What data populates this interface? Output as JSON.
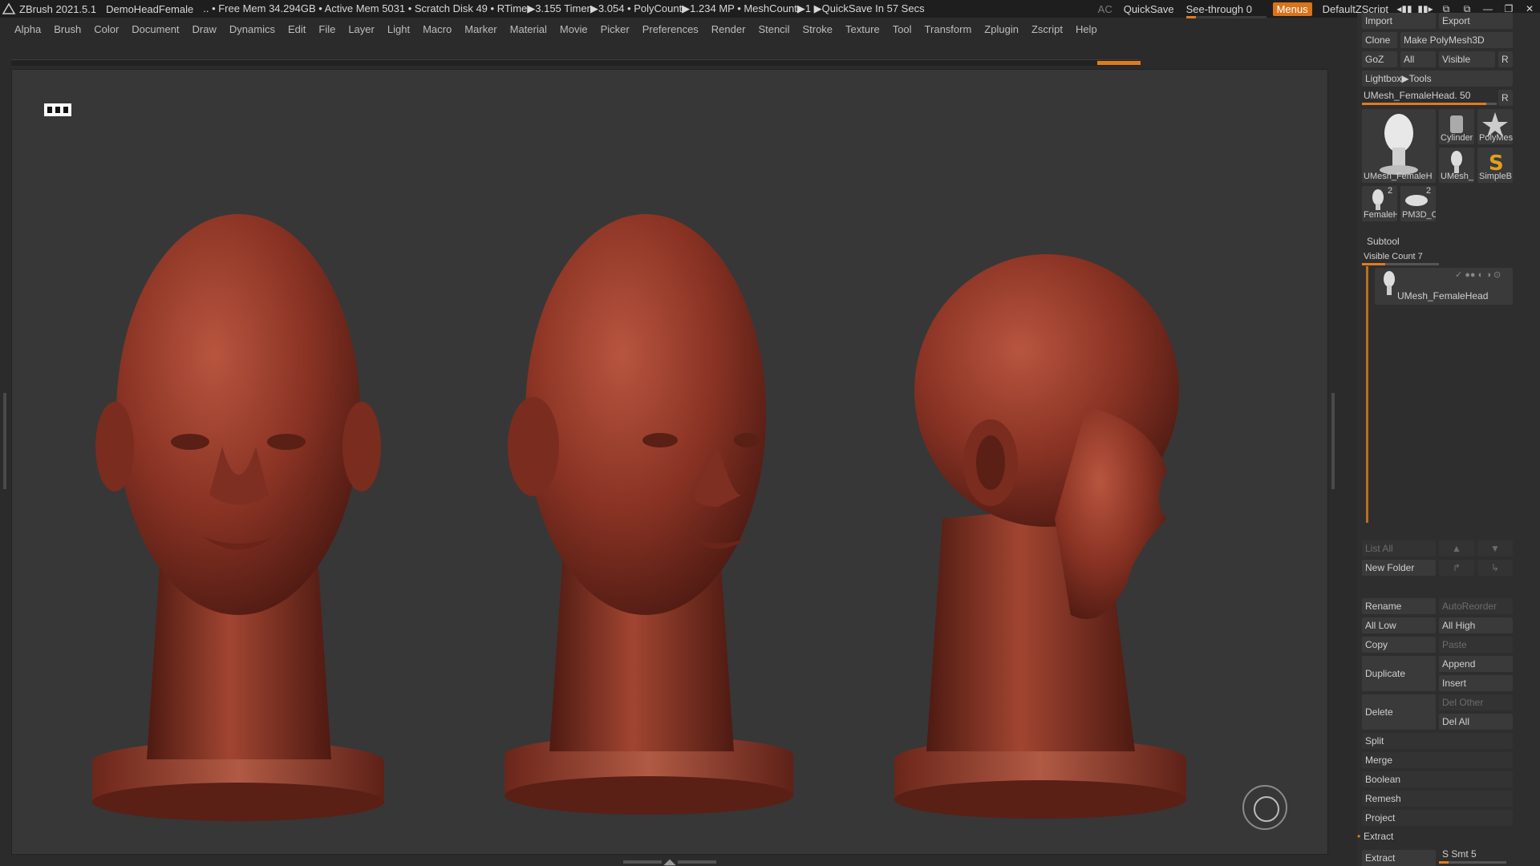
{
  "titlebar": {
    "app": "ZBrush 2021.5.1",
    "document": "DemoHeadFemale",
    "stats": ".. • Free Mem 34.294GB • Active Mem 5031 • Scratch Disk 49 • RTime▶3.155 Timer▶3.054 • PolyCount▶1.234 MP • MeshCount▶1 ▶QuickSave In 57 Secs",
    "ac": "AC",
    "quicksave": "QuickSave",
    "seethrough_label": "See-through",
    "seethrough_value": "0",
    "menus": "Menus",
    "zscript": "DefaultZScript"
  },
  "menubar": [
    "Alpha",
    "Brush",
    "Color",
    "Document",
    "Draw",
    "Dynamics",
    "Edit",
    "File",
    "Layer",
    "Light",
    "Macro",
    "Marker",
    "Material",
    "Movie",
    "Picker",
    "Preferences",
    "Render",
    "Stencil",
    "Stroke",
    "Texture",
    "Tool",
    "Transform",
    "Zplugin",
    "Zscript",
    "Help"
  ],
  "palette": {
    "import": "Import",
    "export": "Export",
    "clone": "Clone",
    "make_polymesh": "Make PolyMesh3D",
    "goz": "GoZ",
    "all": "All",
    "visible": "Visible",
    "r": "R",
    "lightbox_tools": "Lightbox▶Tools",
    "current_tool": "UMesh_FemaleHead. 50",
    "tools": [
      {
        "label": "UMesh_FemaleH"
      },
      {
        "label": "Cylinder"
      },
      {
        "label": "PolyMes"
      },
      {
        "label": "UMesh_"
      },
      {
        "label": "SimpleB"
      },
      {
        "label": "FemaleH"
      },
      {
        "label": "PM3D_C"
      }
    ],
    "tool_badges": [
      "2",
      "2"
    ],
    "subtool_title": "Subtool",
    "visible_count": "Visible Count 7",
    "subtool_item": "UMesh_FemaleHead",
    "list_all": "List All",
    "new_folder": "New Folder",
    "rename": "Rename",
    "autoreorder": "AutoReorder",
    "all_low": "All Low",
    "all_high": "All High",
    "copy": "Copy",
    "paste": "Paste",
    "duplicate": "Duplicate",
    "append": "Append",
    "insert": "Insert",
    "delete": "Delete",
    "del_other": "Del Other",
    "del_all": "Del All",
    "split": "Split",
    "merge": "Merge",
    "boolean": "Boolean",
    "remesh": "Remesh",
    "project": "Project",
    "extract_section": "Extract",
    "extract_btn": "Extract",
    "s_smt": "S Smt 5"
  },
  "colors": {
    "accent": "#e07a22",
    "clay": "#8a3324",
    "viewport_bg": "#373737"
  }
}
